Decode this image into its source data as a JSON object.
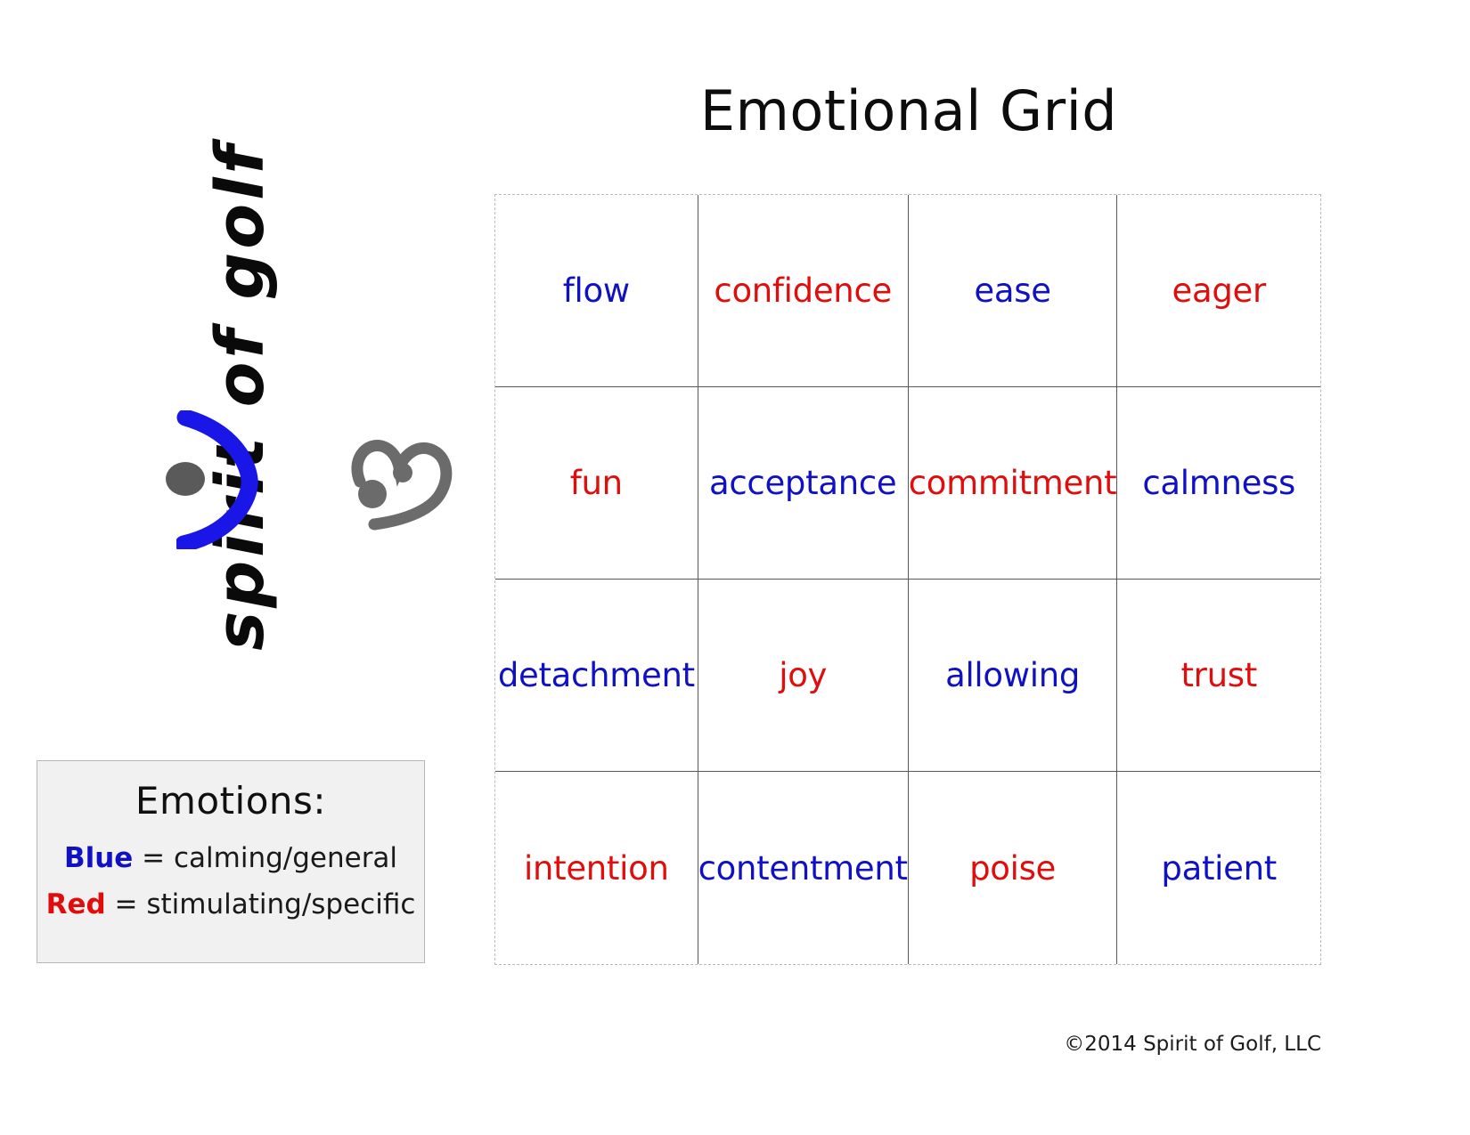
{
  "page": {
    "title": "Emotional Grid",
    "copyright": "©2014 Spirit of Golf, LLC"
  },
  "logo": {
    "wordmark": "spirit of golf",
    "eye_color": "#5a5a5a",
    "smile_color": "#1a16e8",
    "heart_color": "#6b6b6b"
  },
  "legend": {
    "title": "Emotions:",
    "rows": [
      {
        "key": "Blue",
        "equals": " = ",
        "meaning": "calming/general",
        "color": "#1111c4"
      },
      {
        "key": "Red",
        "equals": " = ",
        "meaning": "stimulating/specific",
        "color": "#e00d0d"
      }
    ]
  },
  "colors": {
    "blue": "#1111c4",
    "red": "#e00d0d",
    "grid_inner_line": "#595959",
    "grid_outer_dash": "#b9b9b9",
    "legend_bg": "#f1f1f1"
  },
  "grid": {
    "rows": 4,
    "cols": 4,
    "cells": [
      {
        "label": "flow",
        "tone": "blue"
      },
      {
        "label": "confidence",
        "tone": "red"
      },
      {
        "label": "ease",
        "tone": "blue"
      },
      {
        "label": "eager",
        "tone": "red"
      },
      {
        "label": "fun",
        "tone": "red"
      },
      {
        "label": "acceptance",
        "tone": "blue"
      },
      {
        "label": "commitment",
        "tone": "red"
      },
      {
        "label": "calmness",
        "tone": "blue"
      },
      {
        "label": "detachment",
        "tone": "blue"
      },
      {
        "label": "joy",
        "tone": "red"
      },
      {
        "label": "allowing",
        "tone": "blue"
      },
      {
        "label": "trust",
        "tone": "red"
      },
      {
        "label": "intention",
        "tone": "red"
      },
      {
        "label": "contentment",
        "tone": "blue"
      },
      {
        "label": "poise",
        "tone": "red"
      },
      {
        "label": "patient",
        "tone": "blue"
      }
    ]
  }
}
